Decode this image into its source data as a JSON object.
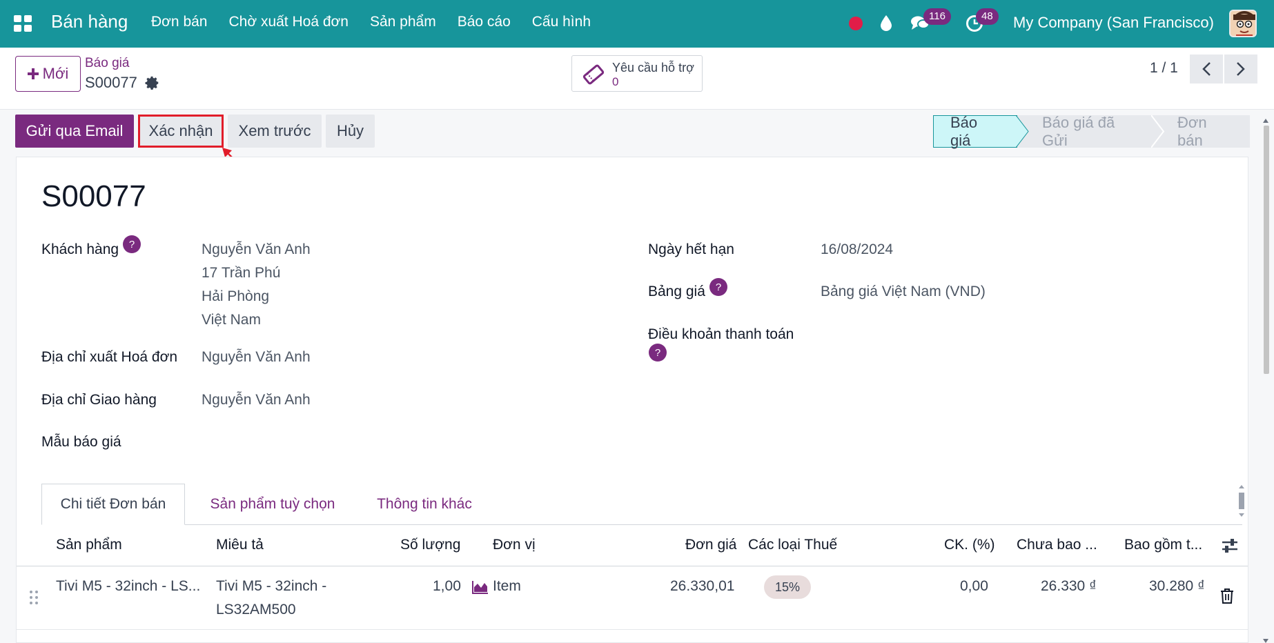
{
  "topbar": {
    "app_name": "Bán hàng",
    "menu": [
      "Đơn bán",
      "Chờ xuất Hoá đơn",
      "Sản phẩm",
      "Báo cáo",
      "Cấu hình"
    ],
    "chat_count": "116",
    "activity_count": "48",
    "company": "My Company (San Francisco)"
  },
  "control": {
    "new_label": "Mới",
    "breadcrumb_parent": "Báo giá",
    "breadcrumb_current": "S00077",
    "ticket_label": "Yêu cầu hỗ trợ",
    "ticket_count": "0",
    "pager": "1 / 1"
  },
  "actions": {
    "send_email": "Gửi qua Email",
    "confirm": "Xác nhận",
    "preview": "Xem trước",
    "cancel": "Hủy"
  },
  "status": [
    "Báo giá",
    "Báo giá đã Gửi",
    "Đơn bán"
  ],
  "form": {
    "title": "S00077",
    "customer_label": "Khách hàng",
    "customer_lines": [
      "Nguyễn Văn Anh",
      "17 Trần Phú",
      "Hải Phòng",
      "Việt Nam"
    ],
    "invoice_address_label": "Địa chỉ xuất Hoá đơn",
    "invoice_address": "Nguyễn Văn Anh",
    "delivery_address_label": "Địa chỉ Giao hàng",
    "delivery_address": "Nguyễn Văn Anh",
    "template_label": "Mẫu báo giá",
    "expiry_label": "Ngày hết hạn",
    "expiry": "16/08/2024",
    "pricelist_label": "Bảng giá",
    "pricelist": "Bảng giá Việt Nam (VND)",
    "payment_terms_label": "Điều khoản thanh toán",
    "help_mark": "?"
  },
  "tabs": [
    "Chi tiết Đơn bán",
    "Sản phẩm tuỳ chọn",
    "Thông tin khác"
  ],
  "table": {
    "headers": [
      "Sản phẩm",
      "Miêu tả",
      "Số lượng",
      "Đơn vị",
      "Đơn giá",
      "Các loại Thuế",
      "CK. (%)",
      "Chưa bao ...",
      "Bao gồm t..."
    ],
    "rows": [
      {
        "product": "Tivi M5 - 32inch - LS...",
        "description_1": "Tivi M5 - 32inch -",
        "description_2": "LS32AM500",
        "quantity": "1,00",
        "uom": "Item",
        "price": "26.330,01",
        "tax": "15%",
        "discount": "0,00",
        "subtotal": "26.330 ₫",
        "total": "30.280 ₫"
      }
    ]
  }
}
